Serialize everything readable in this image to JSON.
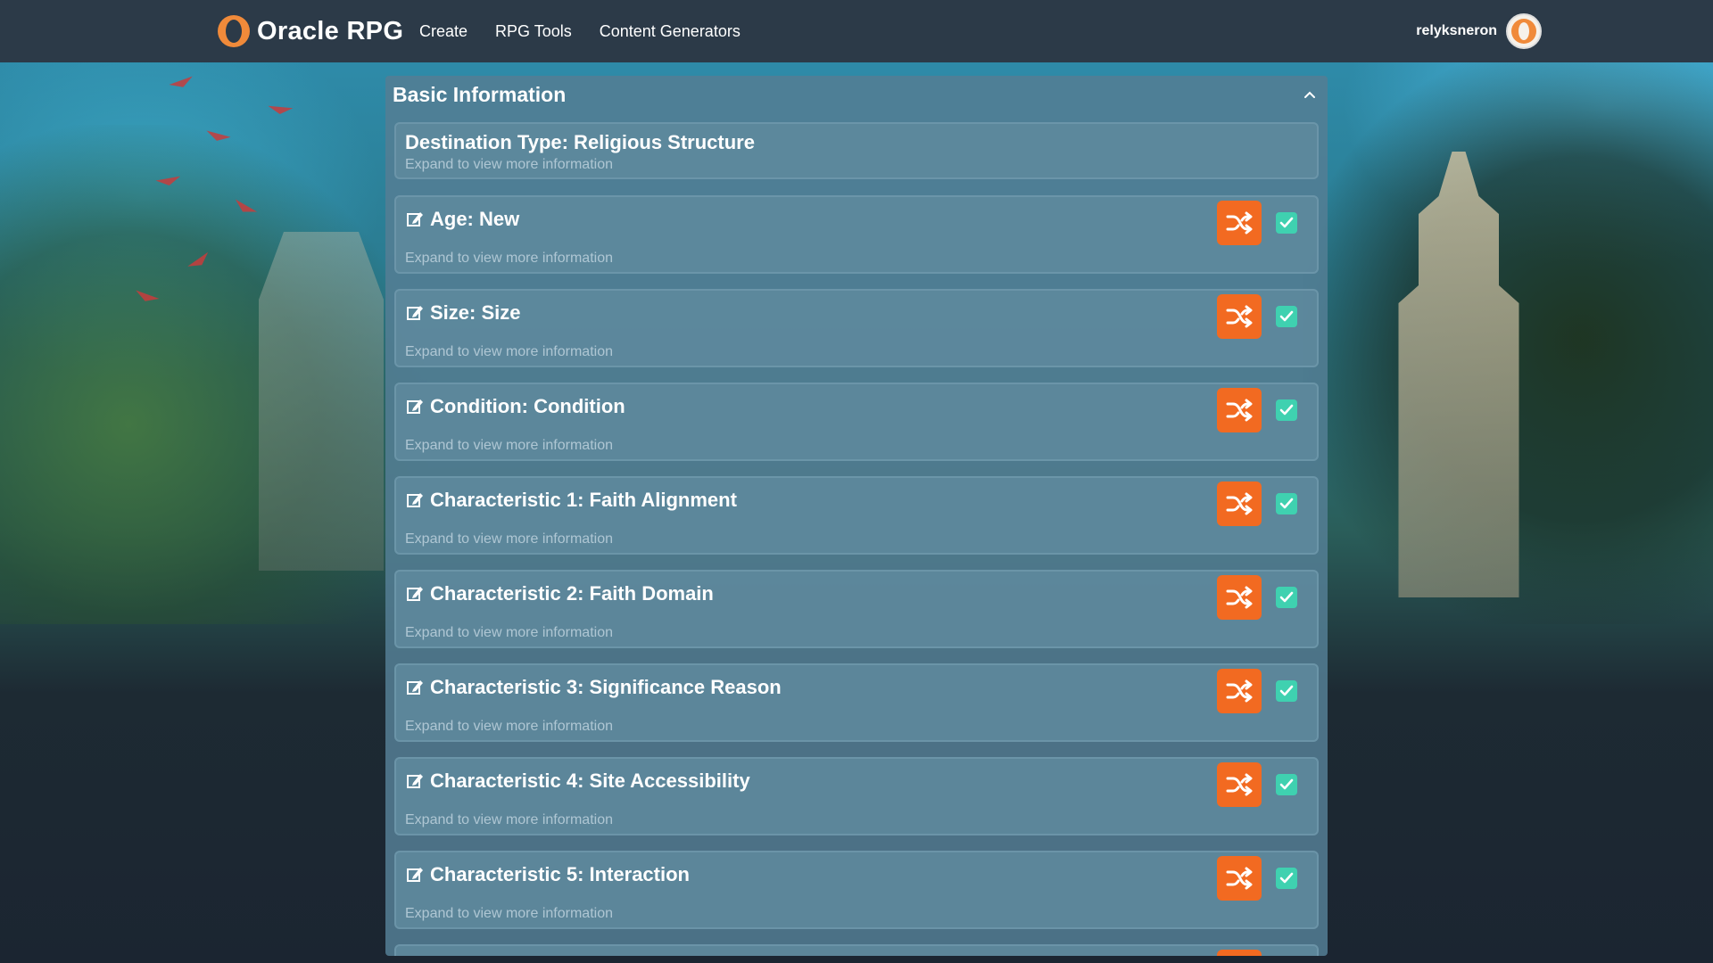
{
  "app": {
    "brand": "Oracle RPG",
    "nav": [
      "Create",
      "RPG Tools",
      "Content Generators"
    ],
    "username": "relyksneron"
  },
  "panel": {
    "title": "Basic Information",
    "header_card": {
      "title": "Destination Type: Religious Structure",
      "subtitle": "Expand to view more information"
    },
    "items": [
      {
        "title": "Age: New",
        "subtitle": "Expand to view more information",
        "checked": true
      },
      {
        "title": "Size: Size",
        "subtitle": "Expand to view more information",
        "checked": true
      },
      {
        "title": "Condition: Condition",
        "subtitle": "Expand to view more information",
        "checked": true
      },
      {
        "title": "Characteristic 1: Faith Alignment",
        "subtitle": "Expand to view more information",
        "checked": true
      },
      {
        "title": "Characteristic 2: Faith Domain",
        "subtitle": "Expand to view more information",
        "checked": true
      },
      {
        "title": "Characteristic 3: Significance Reason",
        "subtitle": "Expand to view more information",
        "checked": true
      },
      {
        "title": "Characteristic 4: Site Accessibility",
        "subtitle": "Expand to view more information",
        "checked": true
      },
      {
        "title": "Characteristic 5: Interaction",
        "subtitle": "Expand to view more information",
        "checked": true
      }
    ]
  },
  "colors": {
    "accent_orange": "#f26a21",
    "check_teal": "#3fd1b0",
    "topbar": "#2c3a48"
  },
  "icons": {
    "edit": "edit-icon",
    "shuffle": "shuffle-icon",
    "check": "check-icon",
    "collapse": "chevron-up-icon"
  }
}
